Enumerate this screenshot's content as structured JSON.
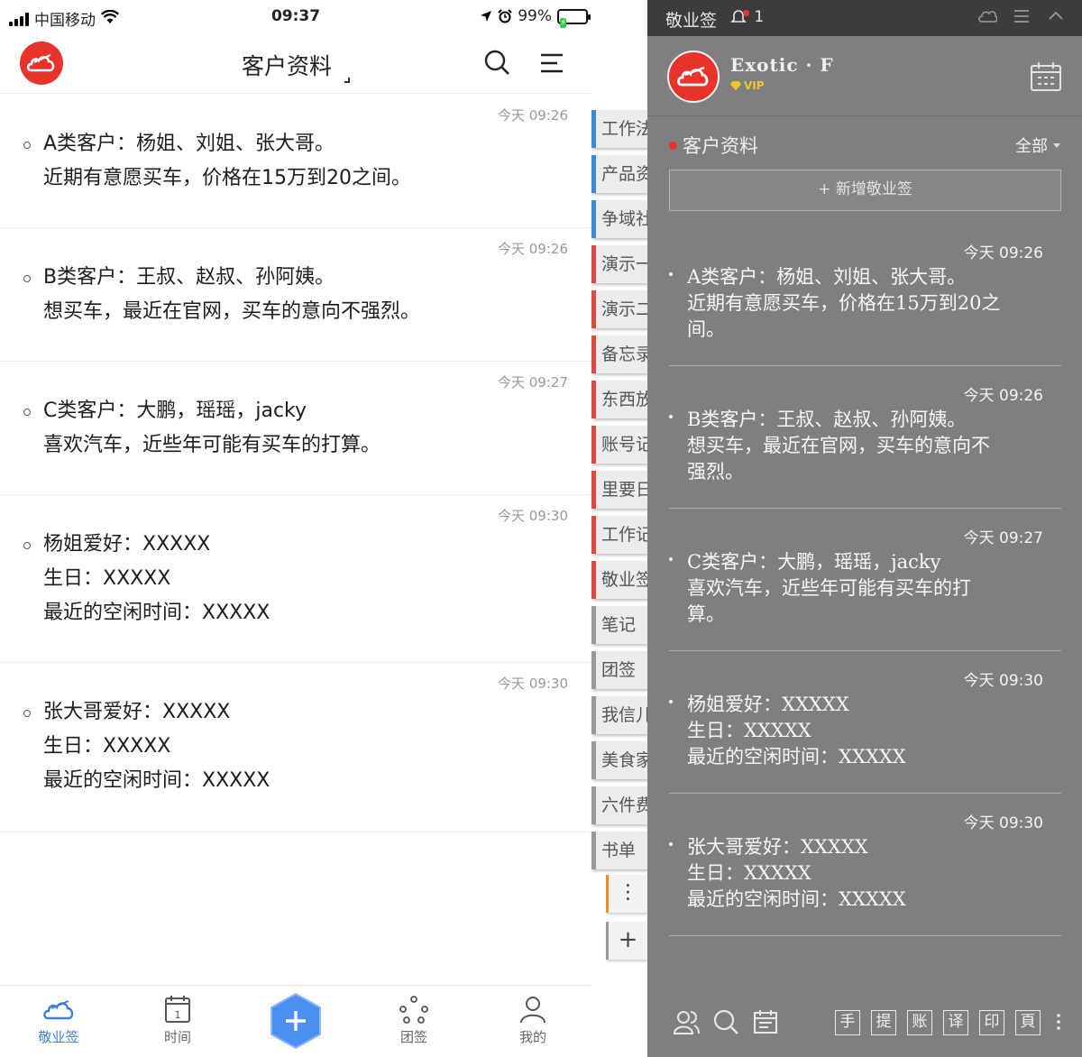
{
  "phone": {
    "status": {
      "carrier": "中国移动",
      "time": "09:37",
      "battery": "99%"
    },
    "header": {
      "title": "客户资料"
    },
    "notes": [
      {
        "time": "今天 09:26",
        "lines": [
          "A类客户：杨姐、刘姐、张大哥。",
          "近期有意愿买车，价格在15万到20之间。"
        ]
      },
      {
        "time": "今天 09:26",
        "lines": [
          "B类客户：王叔、赵叔、孙阿姨。",
          "想买车，最近在官网，买车的意向不强烈。"
        ]
      },
      {
        "time": "今天 09:27",
        "lines": [
          "C类客户：大鹏，瑶瑶，jacky",
          "喜欢汽车，近些年可能有买车的打算。"
        ]
      },
      {
        "time": "今天 09:30",
        "lines": [
          "杨姐爱好：XXXXX",
          "生日：XXXXX",
          "最近的空闲时间：XXXXX"
        ]
      },
      {
        "time": "今天 09:30",
        "lines": [
          "张大哥爱好：XXXXX",
          "生日：XXXXX",
          "最近的空闲时间：XXXXX"
        ]
      }
    ],
    "side_tabs": [
      {
        "label": "工作法",
        "color": "blue"
      },
      {
        "label": "产品资",
        "color": "blue"
      },
      {
        "label": "争域社",
        "color": "blue"
      },
      {
        "label": "演示一",
        "color": "red"
      },
      {
        "label": "演示二",
        "color": "red"
      },
      {
        "label": "备忘录",
        "color": "red"
      },
      {
        "label": "东西放",
        "color": "red"
      },
      {
        "label": "账号记",
        "color": "red"
      },
      {
        "label": "里要日",
        "color": "red"
      },
      {
        "label": "工作记",
        "color": "red"
      },
      {
        "label": "敬业签",
        "color": "red"
      },
      {
        "label": "笔记",
        "color": "gray"
      },
      {
        "label": "团签",
        "color": "gray"
      },
      {
        "label": "我信儿",
        "color": "gray"
      },
      {
        "label": "美食家",
        "color": "gray"
      },
      {
        "label": "六件费",
        "color": "gray"
      },
      {
        "label": "书单",
        "color": "gray"
      }
    ],
    "side_more": "⋮",
    "side_add": "+",
    "tabbar": {
      "items": [
        {
          "label": "敬业签",
          "icon": "cloud-icon"
        },
        {
          "label": "时间",
          "icon": "calendar-icon"
        },
        {
          "label": "团签",
          "icon": "team-icon"
        },
        {
          "label": "我的",
          "icon": "user-icon"
        }
      ],
      "fab": "+"
    }
  },
  "desktop": {
    "topbar": {
      "title": "敬业签",
      "notify_count": "1"
    },
    "user": {
      "name": "Exotic · F",
      "badge": "VIP"
    },
    "category": "客户资料",
    "filter": "全部",
    "new_note": "+ 新增敬业签",
    "notes": [
      {
        "time": "今天  09:26",
        "lines": [
          "A类客户：杨姐、刘姐、张大哥。",
          "近期有意愿买车，价格在15万到20之",
          "间。"
        ]
      },
      {
        "time": "今天  09:26",
        "lines": [
          "B类客户：王叔、赵叔、孙阿姨。",
          "想买车，最近在官网，买车的意向不",
          "强烈。"
        ]
      },
      {
        "time": "今天  09:27",
        "lines": [
          "C类客户：大鹏，瑶瑶，jacky",
          "喜欢汽车，近些年可能有买车的打",
          "算。"
        ]
      },
      {
        "time": "今天  09:30",
        "lines": [
          "杨姐爱好：XXXXX",
          "生日：XXXXX",
          "最近的空闲时间：XXXXX"
        ]
      },
      {
        "time": "今天  09:30",
        "lines": [
          "张大哥爱好：XXXXX",
          "生日：XXXXX",
          "最近的空闲时间：XXXXX"
        ]
      }
    ],
    "bottom_buttons": [
      "手",
      "提",
      "账",
      "译",
      "印",
      "頁"
    ]
  },
  "colors": {
    "brand_red": "#e8322c",
    "accent_blue": "#3b7fd6",
    "desktop_bg": "#7f7f7f"
  }
}
